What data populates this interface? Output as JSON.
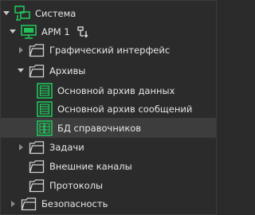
{
  "tree": {
    "root": {
      "label": "Система",
      "icon": "system-network-icon",
      "expanded": true
    },
    "arm": {
      "label": "АРМ 1",
      "icon": "workstation-icon",
      "action_icon": "sort-icon",
      "expanded": true
    },
    "graphic_interface": {
      "label": "Графический интерфейс",
      "icon": "folder-icon",
      "expanded": false
    },
    "archives": {
      "label": "Архивы",
      "icon": "folder-icon",
      "expanded": true
    },
    "archive_data": {
      "label": "Основной архив данных",
      "icon": "archive-icon"
    },
    "archive_messages": {
      "label": "Основной архив сообщений",
      "icon": "archive-icon"
    },
    "reference_db": {
      "label": "БД справочников",
      "icon": "database-icon",
      "selected": true
    },
    "tasks": {
      "label": "Задачи",
      "icon": "folder-icon",
      "expanded": false
    },
    "external_channels": {
      "label": "Внешние каналы",
      "icon": "folder-icon"
    },
    "protocols": {
      "label": "Протоколы",
      "icon": "folder-icon"
    },
    "security": {
      "label": "Безопасность",
      "icon": "folder-icon",
      "expanded": false
    }
  },
  "colors": {
    "background": "#2b2b2b",
    "selected_row": "#3d3d3d",
    "accent_green": "#22c25b",
    "folder_stroke": "#d0d0d0",
    "text": "#e6e6e6"
  }
}
